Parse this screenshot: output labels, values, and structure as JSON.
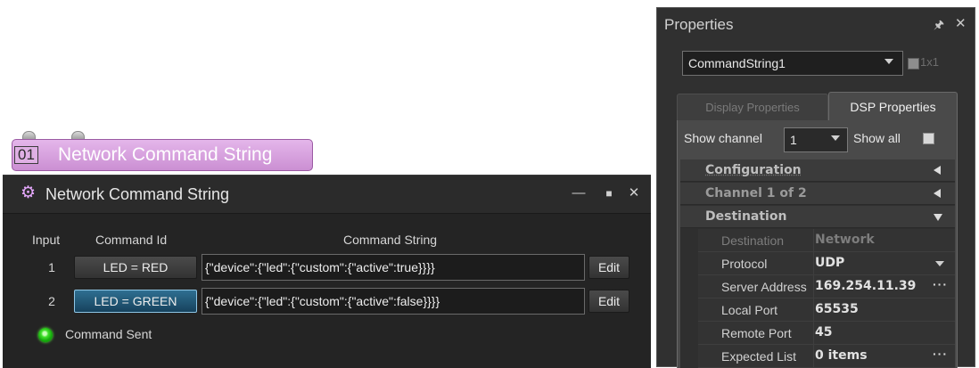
{
  "block": {
    "number": "01",
    "title": "Network Command String"
  },
  "dialog": {
    "title": "Network Command String",
    "columns": {
      "input": "Input",
      "command_id": "Command Id",
      "command_string": "Command String"
    },
    "rows": [
      {
        "input": "1",
        "command_id": "LED = RED",
        "command_string": "{\"device\":{\"led\":{\"custom\":{\"active\":true}}}}",
        "edit": "Edit"
      },
      {
        "input": "2",
        "command_id": "LED = GREEN",
        "command_string": "{\"device\":{\"led\":{\"custom\":{\"active\":false}}}}",
        "edit": "Edit"
      }
    ],
    "status": "Command Sent"
  },
  "properties": {
    "title": "Properties",
    "object_selector": "CommandString1",
    "grid_toggle_label": "1x1",
    "tabs": {
      "display": "Display Properties",
      "dsp": "DSP Properties"
    },
    "show_channel_label": "Show channel",
    "show_channel_value": "1",
    "show_all_label": "Show all",
    "sections": {
      "configuration": "Configuration",
      "channel": "Channel 1 of 2",
      "destination": "Destination"
    },
    "fields": [
      {
        "name": "Destination",
        "value": "Network"
      },
      {
        "name": "Protocol",
        "value": "UDP"
      },
      {
        "name": "Server Address",
        "value": "169.254.11.39"
      },
      {
        "name": "Local Port",
        "value": "65535"
      },
      {
        "name": "Remote Port",
        "value": "45"
      },
      {
        "name": "Expected List",
        "value": "0 items"
      }
    ]
  },
  "colors": {
    "block_fill": "#d39cdb",
    "active_button": "#1f587a",
    "led_green": "#3fe02a"
  }
}
